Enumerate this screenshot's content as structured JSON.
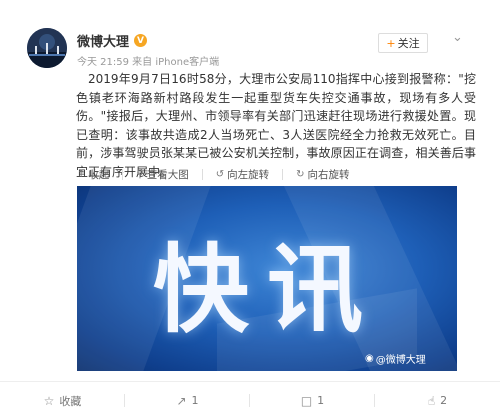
{
  "account": {
    "name": "微博大理",
    "verified_mark": "V",
    "meta": "今天 21:59 来自 iPhone客户端"
  },
  "header_actions": {
    "follow_label": "关注",
    "follow_plus": "+",
    "more_icon": "chevron-down-icon"
  },
  "post": {
    "text": "2019年9月7日16时58分，大理市公安局110指挥中心接到报警称：\"挖色镇老环海路新村路段发生一起重型货车失控交通事故，现场有多人受伤。\"接报后，大理州、市领导率有关部门迅速赶往现场进行救援处置。现已查明：该事故共造成2人当场死亡、3人送医院经全力抢救无效死亡。目前，涉事驾驶员张某某已被公安机关控制，事故原因正在调查，相关善后事宜正有序开展中。"
  },
  "image_toolbar": {
    "collapse": "收起",
    "view_large": "查看大图",
    "rotate_left": "向左旋转",
    "rotate_right": "向右旋转"
  },
  "image": {
    "title": "快讯",
    "watermark": "@微博大理"
  },
  "footer": {
    "favorite_label": "收藏",
    "repost_count": "1",
    "comment_count": "1",
    "like_count": "2"
  },
  "colors": {
    "accent_orange": "#ff8200",
    "verified_gold": "#f6a623",
    "image_blue": "#1e5fb7"
  }
}
